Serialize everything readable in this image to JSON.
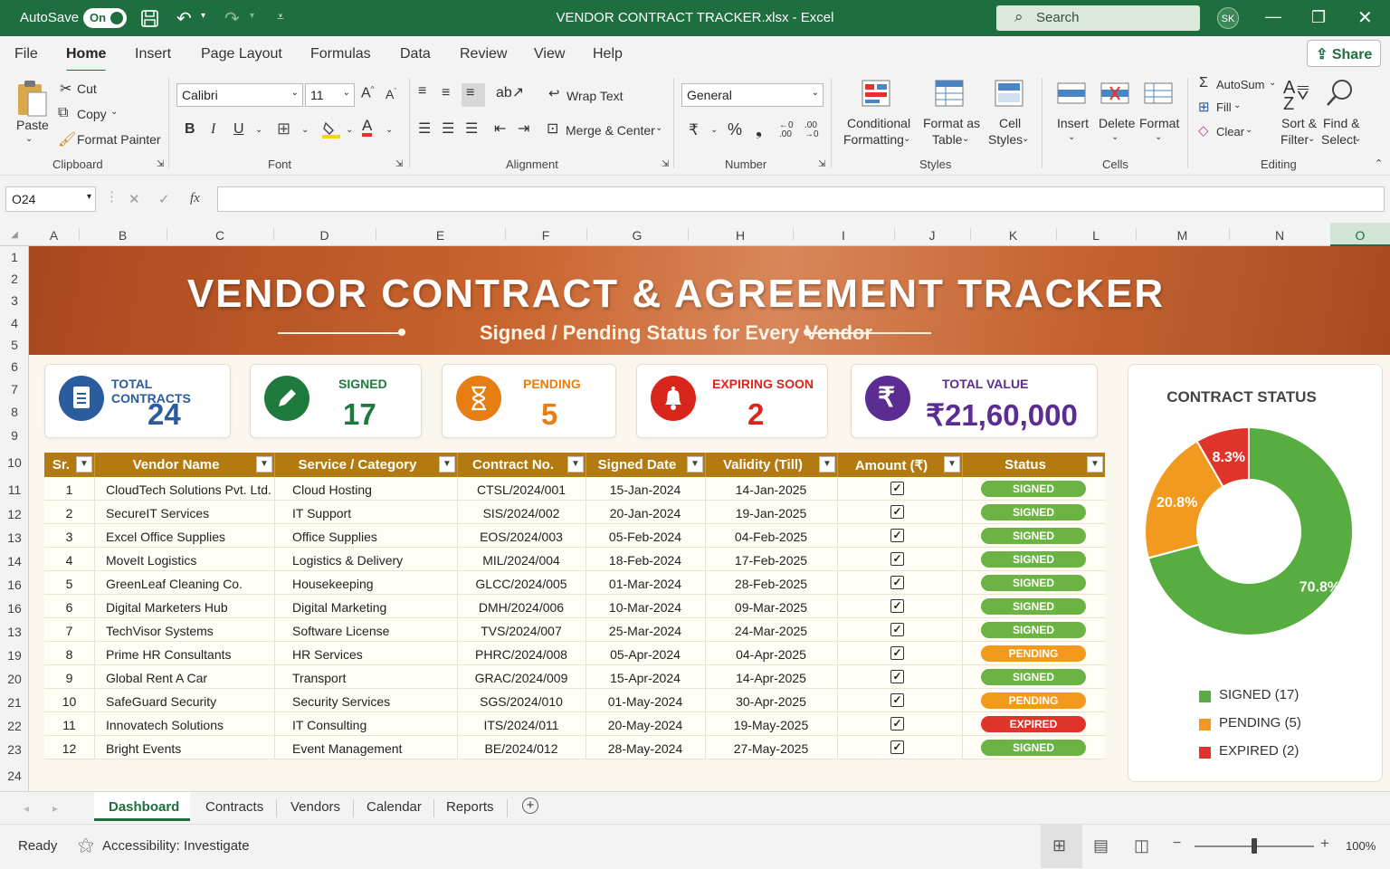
{
  "app": {
    "autosave_label": "AutoSave",
    "autosave_state": "On",
    "window_title": "VENDOR CONTRACT TRACKER.xlsx  -  Excel",
    "search_placeholder": "Search",
    "user_initials": "SK",
    "share_label": "Share"
  },
  "menu": [
    "File",
    "Home",
    "Insert",
    "Page Layout",
    "Formulas",
    "Data",
    "Review",
    "View",
    "Help"
  ],
  "ribbon": {
    "clipboard": {
      "paste": "Paste",
      "cut": "Cut",
      "copy": "Copy",
      "format_painter": "Format Painter",
      "group": "Clipboard"
    },
    "font": {
      "name": "Calibri",
      "size": "11",
      "group": "Font"
    },
    "alignment": {
      "wrap": "Wrap Text",
      "merge": "Merge & Center",
      "group": "Alignment"
    },
    "number": {
      "format": "General",
      "currency": "₹",
      "percent": "%",
      "comma": "❟",
      "group": "Number"
    },
    "styles": {
      "conditional": "Conditional",
      "conditional2": "Formatting",
      "format_table": "Format as",
      "format_table2": "Table",
      "cell_styles": "Cell",
      "cell_styles2": "Styles",
      "group": "Styles"
    },
    "cells": {
      "insert": "Insert",
      "delete": "Delete",
      "format": "Format",
      "group": "Cells"
    },
    "editing": {
      "autosum": "AutoSum",
      "fill": "Fill",
      "clear": "Clear",
      "sort": "Sort &",
      "sort2": "Filter",
      "find": "Find &",
      "find2": "Select",
      "group": "Editing"
    }
  },
  "formula_bar": {
    "name_box": "O24",
    "fx": "fx",
    "formula": ""
  },
  "columns": [
    "A",
    "B",
    "C",
    "D",
    "E",
    "F",
    "G",
    "H",
    "I",
    "J",
    "K",
    "L",
    "M",
    "N",
    "O"
  ],
  "rows": [
    "1",
    "2",
    "3",
    "4",
    "5",
    "6",
    "7",
    "8",
    "9",
    "10",
    "11",
    "12",
    "13",
    "14",
    "16",
    "16",
    "13",
    "19",
    "20",
    "21",
    "22",
    "23",
    "24"
  ],
  "banner": {
    "title": "VENDOR CONTRACT & AGREEMENT TRACKER",
    "subtitle": "Signed / Pending Status for Every Vendor"
  },
  "kpis": [
    {
      "label": "TOTAL CONTRACTS",
      "value": "24",
      "color": "#2a5c9e",
      "icon": "document-icon"
    },
    {
      "label": "SIGNED",
      "value": "17",
      "color": "#1f7a3e",
      "icon": "pencil-icon"
    },
    {
      "label": "PENDING",
      "value": "5",
      "color": "#e67e14",
      "icon": "hourglass-icon"
    },
    {
      "label": "EXPIRING SOON",
      "value": "2",
      "color": "#d9261c",
      "icon": "bell-icon"
    },
    {
      "label": "TOTAL VALUE",
      "value": "₹21,60,000",
      "color": "#5b2c91",
      "icon": "rupee-icon"
    }
  ],
  "table": {
    "headers": [
      "Sr.",
      "Vendor Name",
      "Service / Category",
      "Contract No.",
      "Signed Date",
      "Validity (Till)",
      "Amount (₹)",
      "Status"
    ],
    "rows": [
      {
        "sr": "1",
        "vendor": "CloudTech Solutions Pvt. Ltd.",
        "service": "Cloud Hosting",
        "contract": "CTSL/2024/001",
        "signed": "15-Jan-2024",
        "validity": "14-Jan-2025",
        "status": "SIGNED"
      },
      {
        "sr": "2",
        "vendor": "SecureIT Services",
        "service": "IT Support",
        "contract": "SIS/2024/002",
        "signed": "20-Jan-2024",
        "validity": "19-Jan-2025",
        "status": "SIGNED"
      },
      {
        "sr": "3",
        "vendor": "Excel Office Supplies",
        "service": "Office Supplies",
        "contract": "EOS/2024/003",
        "signed": "05-Feb-2024",
        "validity": "04-Feb-2025",
        "status": "SIGNED"
      },
      {
        "sr": "4",
        "vendor": "MoveIt Logistics",
        "service": "Logistics & Delivery",
        "contract": "MIL/2024/004",
        "signed": "18-Feb-2024",
        "validity": "17-Feb-2025",
        "status": "SIGNED"
      },
      {
        "sr": "5",
        "vendor": "GreenLeaf Cleaning Co.",
        "service": "Housekeeping",
        "contract": "GLCC/2024/005",
        "signed": "01-Mar-2024",
        "validity": "28-Feb-2025",
        "status": "SIGNED"
      },
      {
        "sr": "6",
        "vendor": "Digital Marketers Hub",
        "service": "Digital Marketing",
        "contract": "DMH/2024/006",
        "signed": "10-Mar-2024",
        "validity": "09-Mar-2025",
        "status": "SIGNED"
      },
      {
        "sr": "7",
        "vendor": "TechVisor Systems",
        "service": "Software License",
        "contract": "TVS/2024/007",
        "signed": "25-Mar-2024",
        "validity": "24-Mar-2025",
        "status": "SIGNED"
      },
      {
        "sr": "8",
        "vendor": "Prime HR Consultants",
        "service": "HR Services",
        "contract": "PHRC/2024/008",
        "signed": "05-Apr-2024",
        "validity": "04-Apr-2025",
        "status": "PENDING"
      },
      {
        "sr": "9",
        "vendor": "Global Rent A Car",
        "service": "Transport",
        "contract": "GRAC/2024/009",
        "signed": "15-Apr-2024",
        "validity": "14-Apr-2025",
        "status": "SIGNED"
      },
      {
        "sr": "10",
        "vendor": "SafeGuard Security",
        "service": "Security Services",
        "contract": "SGS/2024/010",
        "signed": "01-May-2024",
        "validity": "30-Apr-2025",
        "status": "PENDING"
      },
      {
        "sr": "11",
        "vendor": "Innovatech Solutions",
        "service": "IT Consulting",
        "contract": "ITS/2024/011",
        "signed": "20-May-2024",
        "validity": "19-May-2025",
        "status": "EXPIRED"
      },
      {
        "sr": "12",
        "vendor": "Bright Events",
        "service": "Event Management",
        "contract": "BE/2024/012",
        "signed": "28-May-2024",
        "validity": "27-May-2025",
        "status": "SIGNED"
      }
    ],
    "status_colors": {
      "SIGNED": "#6bb444",
      "PENDING": "#f39a1c",
      "EXPIRED": "#e0342a"
    }
  },
  "chart": {
    "title": "CONTRACT STATUS",
    "slices": [
      {
        "label": "70.8%",
        "value": 70.8,
        "color": "#57ad40"
      },
      {
        "label": "20.8%",
        "value": 20.8,
        "color": "#f29a1f"
      },
      {
        "label": "8.3%",
        "value": 8.3,
        "color": "#e0342a"
      }
    ],
    "legend": [
      {
        "label": "SIGNED (17)",
        "color": "#57ad40"
      },
      {
        "label": "PENDING (5)",
        "color": "#f29a1f"
      },
      {
        "label": "EXPIRED (2)",
        "color": "#e0342a"
      }
    ]
  },
  "chart_data": {
    "type": "pie",
    "title": "CONTRACT STATUS",
    "categories": [
      "SIGNED (17)",
      "PENDING (5)",
      "EXPIRED (2)"
    ],
    "values": [
      70.8,
      20.8,
      8.3
    ],
    "legend": "bottom"
  },
  "sheet_tabs": [
    "Dashboard",
    "Contracts",
    "Vendors",
    "Calendar",
    "Reports"
  ],
  "status": {
    "ready": "Ready",
    "accessibility": "Accessibility: Investigate",
    "zoom": "100%"
  }
}
